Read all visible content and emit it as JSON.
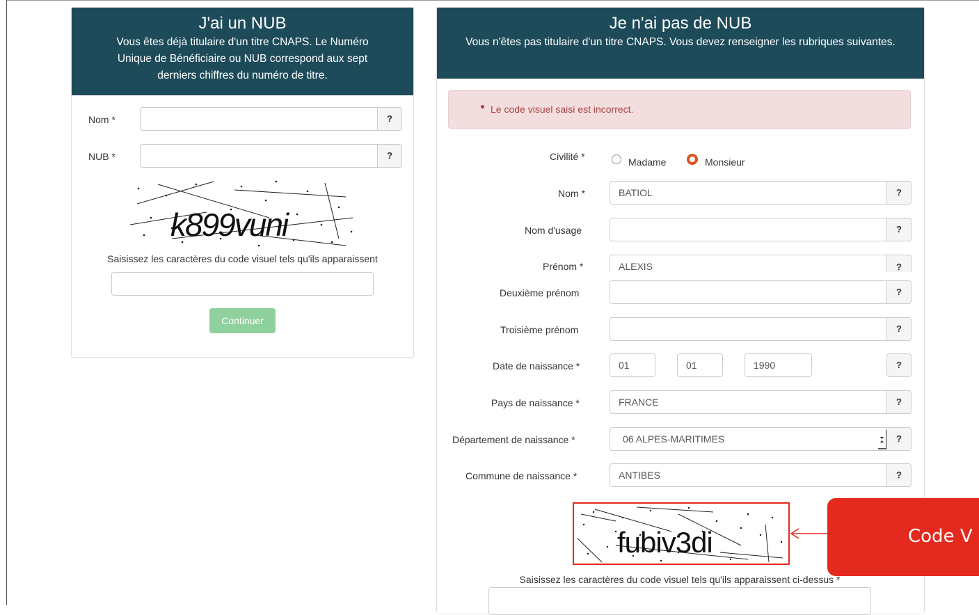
{
  "left_panel": {
    "title": "J'ai un NUB",
    "description": "Vous êtes déjà titulaire d'un titre CNAPS. Le Numéro Unique de Bénéficiaire ou NUB correspond aux sept derniers chiffres du numéro de titre.",
    "fields": [
      {
        "label": "Nom *",
        "value": ""
      },
      {
        "label": "NUB *",
        "value": ""
      }
    ],
    "help_label": "?",
    "captcha_text": "k899vuni",
    "captcha_instruction": "Saisissez les caractères du code visuel tels qu'ils apparaissent",
    "captcha_value": "",
    "continue_label": "Continuer"
  },
  "right_panel": {
    "title": "Je n'ai pas de NUB",
    "description": "Vous n'êtes pas titulaire d'un titre CNAPS. Vous devez renseigner les rubriques suivantes.",
    "error_message": "Le code visuel saisi est incorrect.",
    "civility": {
      "label": "Civilité *",
      "options": [
        "Madame",
        "Monsieur"
      ],
      "selected": "Monsieur"
    },
    "fields": {
      "nom": {
        "label": "Nom *",
        "value": "BATIOL"
      },
      "nom_usage": {
        "label": "Nom d'usage",
        "value": ""
      },
      "prenom": {
        "label": "Prénom *",
        "value": "ALEXIS"
      },
      "deuxieme_prenom": {
        "label": "Deuxième prénom",
        "value": ""
      },
      "troisieme_prenom": {
        "label": "Troisième prénom",
        "value": ""
      },
      "date_naissance": {
        "label": "Date de naissance *",
        "day": "01",
        "month": "01",
        "year": "1990"
      },
      "pays_naissance": {
        "label": "Pays de naissance *",
        "value": "FRANCE"
      },
      "departement_naissance": {
        "label": "Département de naissance *",
        "value": "06 ALPES-MARITIMES"
      },
      "commune_naissance": {
        "label": "Commune de naissance *",
        "value": "ANTIBES"
      }
    },
    "help_label": "?",
    "captcha_text": "fubiv3di",
    "captcha_instruction": "Saisissez les caractères du code visuel tels qu'ils apparaissent ci-dessus *",
    "captcha_value": ""
  },
  "annotation": {
    "callout_text": "Code V",
    "highlight_color": "#e42a1e"
  },
  "colors": {
    "panel_header": "#1e4b5a",
    "error_bg": "#f2dede",
    "error_text": "#a94442",
    "radio_selected": "#d9531e",
    "continue_button": "#8fd19e"
  }
}
